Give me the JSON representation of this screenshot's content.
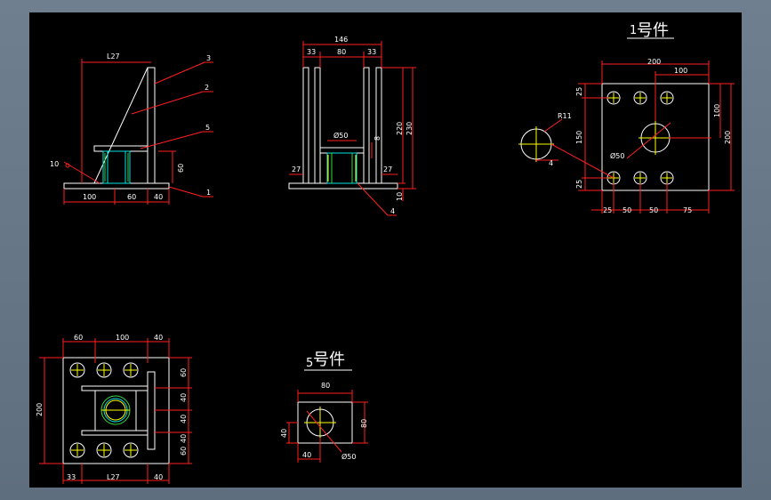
{
  "colors": {
    "background": "#000000",
    "outline": "#ffffff",
    "dimension": "#ff2020",
    "hole": "#ffff00",
    "tube": "#00e5e5",
    "weld": "#33dd33",
    "frame": "#5f6e7e"
  },
  "views": {
    "side": {
      "dim_top": "L27",
      "dim_bottom": [
        "100",
        "60",
        "40"
      ],
      "dim_right": "60",
      "dim_left": "10",
      "leaders": [
        "3",
        "2",
        "5",
        "1"
      ]
    },
    "front": {
      "dim_total": "146",
      "dim_sub": [
        "33",
        "80",
        "33"
      ],
      "dim_hole": "Ø50",
      "dim_gap": "8",
      "dim_h1": "220",
      "dim_h2": "230",
      "dim_left_base": "27",
      "dim_right_base": "27",
      "dim_base": "10",
      "leader": "4"
    },
    "part1": {
      "title_num": "1",
      "title_chars": "号件",
      "dim_top_total": "200",
      "dim_top_right": "100",
      "dim_left": [
        "25",
        "150",
        "25"
      ],
      "dim_right": [
        "100",
        "200"
      ],
      "dim_bottom": [
        "25",
        "50",
        "50",
        "75"
      ],
      "center_hole": "Ø50",
      "detail_r": "R11",
      "detail_w": "4"
    },
    "plan": {
      "dim_top": [
        "60",
        "100",
        "40"
      ],
      "dim_left": "200",
      "dim_right": [
        "60",
        "40",
        "40",
        "40",
        "60"
      ],
      "dim_bottom": [
        "33",
        "L27",
        "40"
      ]
    },
    "part5": {
      "title_num": "5",
      "title_chars": "号件",
      "dim_top": "80",
      "dim_left": "40",
      "dim_right": "80",
      "dim_bottom": "40",
      "hole": "Ø50"
    }
  }
}
